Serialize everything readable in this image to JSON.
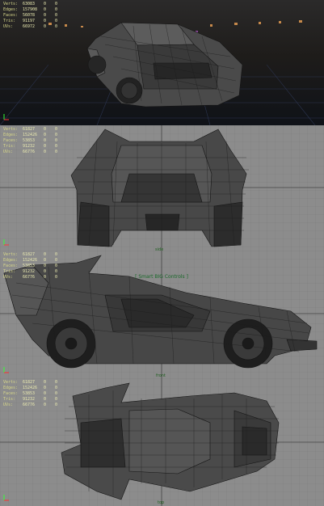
{
  "hud_keys": [
    "Verts:",
    "Edges:",
    "Faces:",
    "Tris:",
    "UVs:"
  ],
  "viewports": [
    {
      "id": "persp",
      "hud_values": [
        [
          "63083",
          "0",
          "0"
        ],
        [
          "157908",
          "0",
          "0"
        ],
        [
          "56078",
          "0",
          "0"
        ],
        [
          "91197",
          "0",
          "0"
        ],
        [
          "66972",
          "0",
          "0"
        ]
      ],
      "camera_label": ""
    },
    {
      "id": "back",
      "hud_values": [
        [
          "61827",
          "0",
          "0"
        ],
        [
          "152426",
          "0",
          "0"
        ],
        [
          "53853",
          "0",
          "0"
        ],
        [
          "91232",
          "0",
          "0"
        ],
        [
          "66776",
          "0",
          "0"
        ]
      ],
      "camera_label": "side"
    },
    {
      "id": "side",
      "hud_values": [
        [
          "61827",
          "0",
          "0"
        ],
        [
          "152426",
          "0",
          "0"
        ],
        [
          "53853",
          "0",
          "0"
        ],
        [
          "91232",
          "0",
          "0"
        ],
        [
          "66776",
          "0",
          "0"
        ]
      ],
      "camera_label": "front",
      "overlay_title": "[ Smart BIG Controls ]"
    },
    {
      "id": "top",
      "hud_values": [
        [
          "61827",
          "0",
          "0"
        ],
        [
          "152426",
          "0",
          "0"
        ],
        [
          "53853",
          "0",
          "0"
        ],
        [
          "91232",
          "0",
          "0"
        ],
        [
          "66776",
          "0",
          "0"
        ]
      ],
      "camera_label": "top"
    }
  ],
  "colors": {
    "viewport_bg": "#8a8a8a",
    "grid": "#777777",
    "hud_text": "#e9e9b0",
    "mesh_dark": "#3c3c3c",
    "mesh_edge": "#1c1c1c",
    "persp_bg": "#1a1e26"
  }
}
